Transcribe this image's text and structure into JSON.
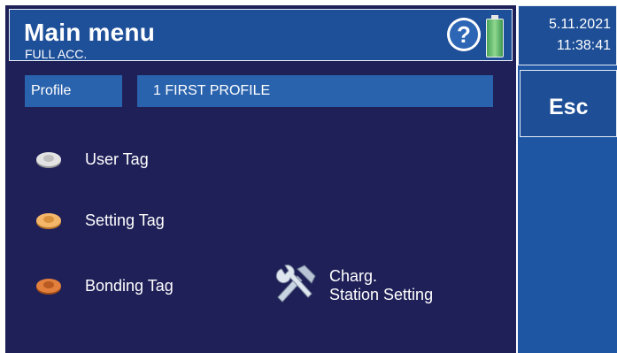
{
  "header": {
    "title": "Main menu",
    "subtitle": "FULL ACC.",
    "help_icon": "help-icon",
    "battery_icon": "battery-icon"
  },
  "profile": {
    "label": "Profile",
    "value": "1 FIRST PROFILE"
  },
  "menu": {
    "user_tag": "User Tag",
    "setting_tag": "Setting Tag",
    "bonding_tag": "Bonding Tag",
    "charging_line1": "Charg.",
    "charging_line2": "Station Setting"
  },
  "sidebar": {
    "date": "5.11.2021",
    "time": "11:38:41",
    "esc_label": "Esc"
  },
  "colors": {
    "background": "#1f2058",
    "header": "#1e4f99",
    "accent": "#2a63ad",
    "sidebar": "#1e56a3"
  }
}
